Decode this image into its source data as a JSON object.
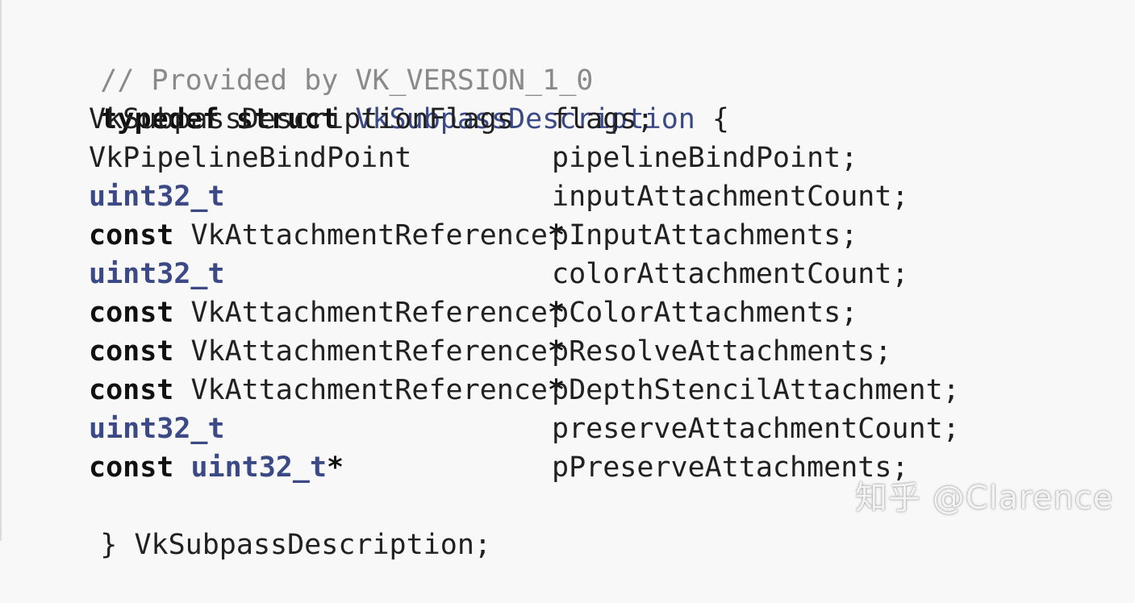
{
  "comment": "// Provided by VK_VERSION_1_0",
  "header": {
    "kw_typedef": "typedef",
    "kw_struct": "struct",
    "name": "VkSubpassDescription",
    "open_brace": "{"
  },
  "members": [
    {
      "qualifier": "",
      "type": "VkSubpassDescriptionFlags",
      "pointer": "",
      "name": "flags;"
    },
    {
      "qualifier": "",
      "type": "VkPipelineBindPoint",
      "pointer": "",
      "name": "pipelineBindPoint;"
    },
    {
      "qualifier": "",
      "type": "uint32_t",
      "pointer": "",
      "name": "inputAttachmentCount;"
    },
    {
      "qualifier": "const",
      "type": "VkAttachmentReference",
      "pointer": "*",
      "name": "pInputAttachments;"
    },
    {
      "qualifier": "",
      "type": "uint32_t",
      "pointer": "",
      "name": "colorAttachmentCount;"
    },
    {
      "qualifier": "const",
      "type": "VkAttachmentReference",
      "pointer": "*",
      "name": "pColorAttachments;"
    },
    {
      "qualifier": "const",
      "type": "VkAttachmentReference",
      "pointer": "*",
      "name": "pResolveAttachments;"
    },
    {
      "qualifier": "const",
      "type": "VkAttachmentReference",
      "pointer": "*",
      "name": "pDepthStencilAttachment;"
    },
    {
      "qualifier": "",
      "type": "uint32_t",
      "pointer": "",
      "name": "preserveAttachmentCount;"
    },
    {
      "qualifier": "const",
      "type": "uint32_t",
      "pointer": "*",
      "name": "pPreserveAttachments;"
    }
  ],
  "footer": {
    "close_brace": "}",
    "typedef_name": "VkSubpassDescription;"
  },
  "watermark": "知乎 @Clarence",
  "colors": {
    "background": "#f8f8f8",
    "comment": "#8a8a8a",
    "type_link": "#3b4a87",
    "text": "#212121"
  }
}
